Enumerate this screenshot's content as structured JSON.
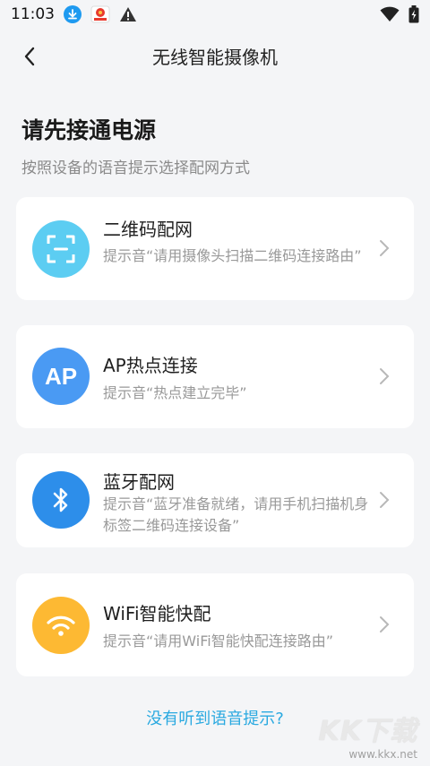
{
  "status_bar": {
    "time": "11:03"
  },
  "nav": {
    "title": "无线智能摄像机"
  },
  "header": {
    "title": "请先接通电源",
    "subtitle": "按照设备的语音提示选择配网方式"
  },
  "options": [
    {
      "title": "二维码配网",
      "desc": "提示音“请用摄像头扫描二维码连接路由”",
      "icon": "qr-scan-icon",
      "color": "#5ccdf2"
    },
    {
      "title": "AP热点连接",
      "desc": "提示音“热点建立完毕”",
      "icon": "ap-icon",
      "icon_text": "AP",
      "color": "#4a9af3"
    },
    {
      "title": "蓝牙配网",
      "desc": "提示音“蓝牙准备就绪，请用手机扫描机身标签二维码连接设备”",
      "icon": "bluetooth-icon",
      "color": "#2d8eea"
    },
    {
      "title": "WiFi智能快配",
      "desc": "提示音“请用WiFi智能快配连接路由”",
      "icon": "wifi-icon",
      "color": "#fdb933"
    }
  ],
  "help_link": "没有听到语音提示?",
  "watermark": {
    "logo": "KK下载",
    "url": "www.kkx.net"
  }
}
